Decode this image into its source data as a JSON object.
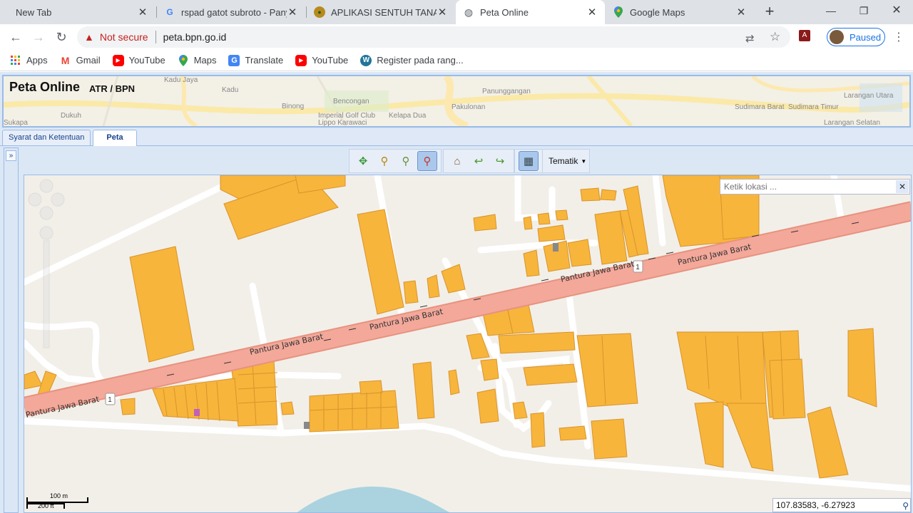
{
  "browser": {
    "tabs": [
      {
        "title": "New Tab",
        "favicon": "none",
        "active": false
      },
      {
        "title": "rspad gatot subroto - Panyl",
        "favicon": "google-icon",
        "active": false
      },
      {
        "title": "APLIKASI SENTUH TANAHK",
        "favicon": "bpn-logo-icon",
        "active": false
      },
      {
        "title": "Peta Online",
        "favicon": "globe-icon",
        "active": true
      },
      {
        "title": "Google Maps",
        "favicon": "maps-pin-icon",
        "active": false
      }
    ],
    "new_tab_symbol": "+",
    "address": {
      "security_label": "Not secure",
      "url": "peta.bpn.go.id"
    },
    "profile_status": "Paused",
    "bookmarks": [
      {
        "label": "Apps",
        "icon": "apps-grid-icon"
      },
      {
        "label": "Gmail",
        "icon": "gmail-icon"
      },
      {
        "label": "YouTube",
        "icon": "youtube-icon"
      },
      {
        "label": "Maps",
        "icon": "maps-pin-icon"
      },
      {
        "label": "Translate",
        "icon": "translate-icon"
      },
      {
        "label": "YouTube",
        "icon": "youtube-icon"
      },
      {
        "label": "Register pada rang...",
        "icon": "wordpress-icon"
      }
    ]
  },
  "app": {
    "title": "Peta Online",
    "subtitle": "ATR / BPN",
    "banner_places": [
      "Kadu Jaya",
      "Kadu",
      "Binong",
      "Bencongan",
      "Imperial Golf Club",
      "Lippo Karawaci",
      "Pakulonan",
      "Kelapa Dua",
      "Panunggangan",
      "Sudimara Barat",
      "Sudimara Timur",
      "Larangan Utara",
      "Dukuh",
      "Sukapa",
      "Larangan Selatan"
    ],
    "tabs": [
      {
        "label": "Syarat dan Ketentuan",
        "selected": false
      },
      {
        "label": "Peta",
        "selected": true
      }
    ],
    "toolbar": {
      "tools": [
        "pan-icon",
        "zoom-in-icon",
        "zoom-box-icon",
        "zoom-out-icon",
        "home-icon",
        "back-icon",
        "forward-icon",
        "layer-icon"
      ],
      "active_tool": "zoom-out-icon",
      "tematik_label": "Tematik"
    },
    "map": {
      "search_placeholder": "Ketik lokasi ...",
      "road_name": "Pantura Jawa Barat",
      "road_shield": "1",
      "scale_top": "100 m",
      "scale_bottom": "200 ft",
      "coordinates": "107.83583, -6.27923",
      "parcel_color": "#f7b53c",
      "road_color": "#f3a89a"
    }
  }
}
